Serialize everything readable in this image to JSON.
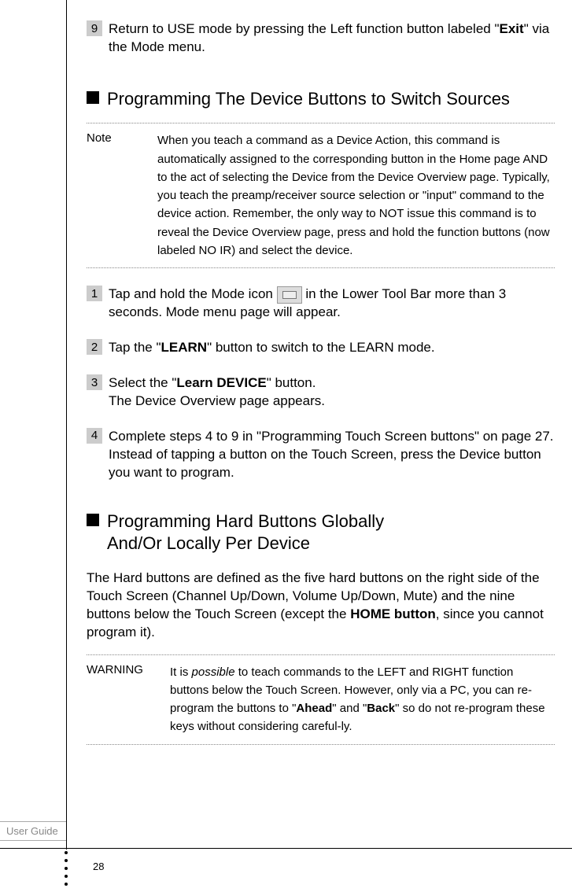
{
  "step9": {
    "num": "9",
    "text_a": "Return to USE mode by pressing the Left function button labeled \"",
    "bold": "Exit",
    "text_b": "\" via the Mode menu."
  },
  "section1": {
    "title": "Programming The Device Buttons to Switch Sources"
  },
  "note1": {
    "label": "Note",
    "text": "When you teach a command as a Device Action, this command is automatically assigned to the corresponding button in the Home page AND to the act of selecting the Device from the Device Overview page. Typically, you teach the preamp/receiver source selection or \"input\" command to the device action. Remember, the only way to NOT issue this command is to reveal the Device Overview page, press and hold the function buttons (now labeled NO IR) and select the device."
  },
  "step1": {
    "num": "1",
    "text_a": "Tap and hold the Mode icon ",
    "text_b": " in the Lower Tool Bar more than 3 seconds. Mode menu page will appear."
  },
  "step2": {
    "num": "2",
    "text_a": "Tap the \"",
    "bold": "LEARN",
    "text_b": "\" button to switch to the LEARN mode."
  },
  "step3": {
    "num": "3",
    "text_a": "Select the \"",
    "bold": "Learn DEVICE",
    "text_b": "\" button.",
    "text_c": "The Device Overview page appears."
  },
  "step4": {
    "num": "4",
    "text": "Complete steps 4 to 9 in \"Programming Touch Screen buttons\" on page 27. Instead of tapping a button on the Touch Screen, press the Device button you want to program."
  },
  "section2": {
    "title_line1": "Programming Hard Buttons Globally",
    "title_line2": "And/Or Locally Per Device"
  },
  "para1": {
    "text_a": "The Hard buttons are defined as the five hard buttons on the right side of the Touch Screen (Channel Up/Down, Volume Up/Down, Mute) and the nine buttons below the Touch Screen (except the ",
    "bold": "HOME button",
    "text_b": ", since you cannot program it)."
  },
  "warning1": {
    "label": "WARNING",
    "text_a": "It is ",
    "italic": "possible",
    "text_b": " to teach commands to the LEFT and RIGHT function buttons below the Touch Screen. However, only via a PC, you can re-program the buttons to \"",
    "bold1": "Ahead",
    "text_c": "\" and \"",
    "bold2": "Back",
    "text_d": "\" so do not re-program these keys without considering careful-ly."
  },
  "footer": {
    "label": "User Guide",
    "page": "28"
  }
}
